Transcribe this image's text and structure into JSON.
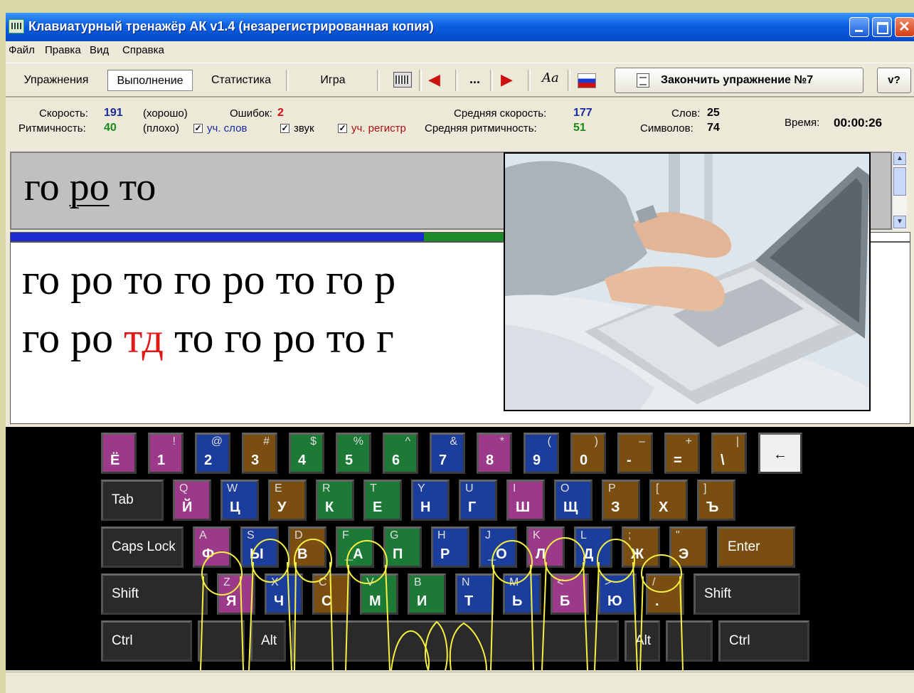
{
  "window": {
    "title": "Клавиатурный тренажёр АК v1.4  (незарегистрированная копия)"
  },
  "menu": [
    "Файл",
    "Правка",
    "Вид",
    "Справка"
  ],
  "toolbar": {
    "exercises": "Упражнения",
    "run": "Выполнение",
    "stats": "Статистика",
    "game": "Игра",
    "dots": "...",
    "font_glyph": "Aa",
    "finish": "Закончить упражнение №7",
    "version": "v?"
  },
  "stats": {
    "speed_label": "Скорость:",
    "speed_value": "191",
    "speed_note": "(хорошо)",
    "errors_label": "Ошибок:",
    "errors_value": "2",
    "avg_speed_label": "Средняя скорость:",
    "avg_speed_value": "177",
    "words_label": "Слов:",
    "words_value": "25",
    "time_label": "Время:",
    "time_value": "00:00:26",
    "rhythm_label": "Ритмичность:",
    "rhythm_value": "40",
    "rhythm_note": "(плохо)",
    "opt_words": "уч. слов",
    "opt_sound": "звук",
    "opt_case": "уч. регистр",
    "avg_rhythm_label": "Средняя ритмичность:",
    "avg_rhythm_value": "51",
    "chars_label": "Символов:",
    "chars_value": "74",
    "colors": {
      "speed": "#1a2aa0",
      "errors": "#d01010",
      "rhythm": "#1a8a1a",
      "words_opt": "#1a2aa0",
      "case_opt": "#b01010"
    }
  },
  "current": {
    "before": "го ",
    "active": "ро",
    "after": " то"
  },
  "progress": [
    {
      "color": "#1a2ad0",
      "fraction": 0.46
    },
    {
      "color": "#1a8a2a",
      "fraction": 0.09
    }
  ],
  "exercise": {
    "line1": "го ро то го ро то го р",
    "line2_a": "го ро ",
    "line2_err": "тд",
    "line2_b": " то го ро то г"
  },
  "keyboard": {
    "rows": [
      [
        {
          "m": "Ё",
          "s": "",
          "l": "",
          "c": "purple"
        },
        {
          "m": "1",
          "s": "!",
          "l": "",
          "c": "purple"
        },
        {
          "m": "2",
          "s": "@",
          "l": "",
          "c": "blue"
        },
        {
          "m": "3",
          "s": "#",
          "l": "",
          "c": "brown"
        },
        {
          "m": "4",
          "s": "$",
          "l": "",
          "c": "green"
        },
        {
          "m": "5",
          "s": "%",
          "l": "",
          "c": "green"
        },
        {
          "m": "6",
          "s": "^",
          "l": "",
          "c": "green"
        },
        {
          "m": "7",
          "s": "&",
          "l": "",
          "c": "blue"
        },
        {
          "m": "8",
          "s": "*",
          "l": "",
          "c": "purple"
        },
        {
          "m": "9",
          "s": "(",
          "l": "",
          "c": "blue"
        },
        {
          "m": "0",
          "s": ")",
          "l": "",
          "c": "brown"
        },
        {
          "m": "-",
          "s": "–",
          "l": "",
          "c": "brown"
        },
        {
          "m": "=",
          "s": "+",
          "l": "",
          "c": "brown"
        },
        {
          "m": "\\",
          "s": "|",
          "l": "",
          "c": "brown"
        },
        {
          "m": "←",
          "s": "",
          "l": "",
          "c": "light"
        }
      ],
      [
        {
          "m": "Tab",
          "s": "",
          "l": "",
          "c": "gray",
          "label": true
        },
        {
          "m": "Й",
          "s": "",
          "l": "Q",
          "c": "purple"
        },
        {
          "m": "Ц",
          "s": "",
          "l": "W",
          "c": "blue"
        },
        {
          "m": "У",
          "s": "",
          "l": "E",
          "c": "brown"
        },
        {
          "m": "К",
          "s": "",
          "l": "R",
          "c": "green"
        },
        {
          "m": "Е",
          "s": "",
          "l": "T",
          "c": "green"
        },
        {
          "m": "Н",
          "s": "",
          "l": "Y",
          "c": "blue"
        },
        {
          "m": "Г",
          "s": "",
          "l": "U",
          "c": "blue"
        },
        {
          "m": "Ш",
          "s": "",
          "l": "I",
          "c": "purple"
        },
        {
          "m": "Щ",
          "s": "",
          "l": "O",
          "c": "blue"
        },
        {
          "m": "З",
          "s": "",
          "l": "P",
          "c": "brown"
        },
        {
          "m": "Х",
          "s": "",
          "l": "[",
          "c": "brown"
        },
        {
          "m": "Ъ",
          "s": "",
          "l": "]",
          "c": "brown"
        }
      ],
      [
        {
          "m": "Caps Lock",
          "s": "",
          "l": "",
          "c": "gray",
          "label": true
        },
        {
          "m": "Ф",
          "s": "",
          "l": "A",
          "c": "purple"
        },
        {
          "m": "Ы",
          "s": "",
          "l": "S",
          "c": "blue"
        },
        {
          "m": "В",
          "s": "",
          "l": "D",
          "c": "brown"
        },
        {
          "m": "_А",
          "s": "",
          "l": "F",
          "c": "green"
        },
        {
          "m": "П",
          "s": "",
          "l": "G",
          "c": "green"
        },
        {
          "m": "Р",
          "s": "",
          "l": "H",
          "c": "blue"
        },
        {
          "m": "_О",
          "s": "",
          "l": "J",
          "c": "blue"
        },
        {
          "m": "Л",
          "s": "",
          "l": "K",
          "c": "purple"
        },
        {
          "m": "Д",
          "s": "",
          "l": "L",
          "c": "blue"
        },
        {
          "m": "Ж",
          "s": "",
          "l": ";",
          "c": "brown"
        },
        {
          "m": "Э",
          "s": "",
          "l": "\"",
          "c": "brown"
        },
        {
          "m": "Enter",
          "s": "",
          "l": "",
          "c": "brown",
          "label": true
        }
      ],
      [
        {
          "m": "Shift",
          "s": "",
          "l": "",
          "c": "gray",
          "label": true
        },
        {
          "m": "Я",
          "s": "",
          "l": "Z",
          "c": "purple"
        },
        {
          "m": "Ч",
          "s": "",
          "l": "X",
          "c": "blue"
        },
        {
          "m": "С",
          "s": "",
          "l": "C",
          "c": "brown"
        },
        {
          "m": "М",
          "s": "",
          "l": "V",
          "c": "green"
        },
        {
          "m": "И",
          "s": "",
          "l": "B",
          "c": "green"
        },
        {
          "m": "Т",
          "s": "",
          "l": "N",
          "c": "blue"
        },
        {
          "m": "Ь",
          "s": "",
          "l": "M",
          "c": "blue"
        },
        {
          "m": "Б",
          "s": "",
          "l": "<",
          "c": "purple"
        },
        {
          "m": "Ю",
          "s": "",
          "l": ">",
          "c": "blue"
        },
        {
          "m": ".",
          "s": "",
          "l": "/",
          "c": "brown"
        },
        {
          "m": "Shift",
          "s": "",
          "l": "",
          "c": "gray",
          "label": true
        }
      ],
      [
        {
          "m": "Ctrl",
          "s": "",
          "l": "",
          "c": "gray",
          "label": true
        },
        {
          "m": "",
          "s": "",
          "l": "",
          "c": "gray"
        },
        {
          "m": "Alt",
          "s": "",
          "l": "",
          "c": "gray",
          "label": true
        },
        {
          "m": "",
          "s": "",
          "l": "",
          "c": "gray"
        },
        {
          "m": "Alt",
          "s": "",
          "l": "",
          "c": "gray",
          "label": true
        },
        {
          "m": "",
          "s": "",
          "l": "",
          "c": "gray"
        },
        {
          "m": "Ctrl",
          "s": "",
          "l": "",
          "c": "gray",
          "label": true
        }
      ]
    ],
    "colors": {
      "purple": "#9a3a88",
      "blue": "#1b3e9c",
      "brown": "#7a4e10",
      "green": "#1c7a36"
    }
  }
}
